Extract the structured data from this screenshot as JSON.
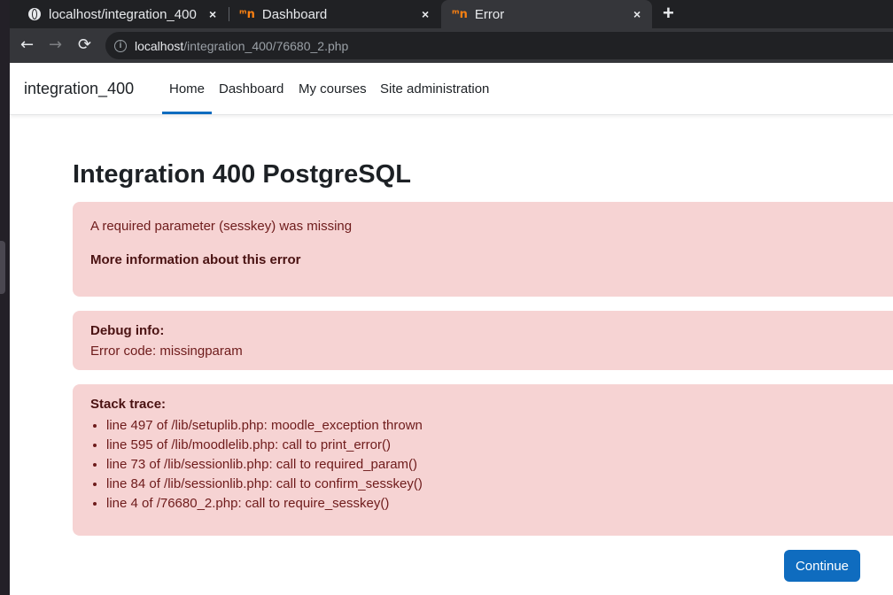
{
  "browser": {
    "tabs": [
      {
        "title": "localhost/integration_400"
      },
      {
        "title": "Dashboard"
      },
      {
        "title": "Error"
      }
    ],
    "new_tab_label": "+",
    "close_label": "×",
    "url_host": "localhost",
    "url_path": "/integration_400/76680_2.php"
  },
  "navbar": {
    "brand": "integration_400",
    "links": [
      "Home",
      "Dashboard",
      "My courses",
      "Site administration"
    ],
    "active": "Home"
  },
  "page": {
    "title": "Integration 400 PostgreSQL",
    "error_message": "A required parameter (sesskey) was missing",
    "more_info": "More information about this error",
    "debug_heading": "Debug info:",
    "debug_text": "Error code: missingparam",
    "stack_heading": "Stack trace:",
    "stack_trace": [
      "line 497 of /lib/setuplib.php: moodle_exception thrown",
      "line 595 of /lib/moodlelib.php: call to print_error()",
      "line 73 of /lib/sessionlib.php: call to required_param()",
      "line 84 of /lib/sessionlib.php: call to confirm_sesskey()",
      "line 4 of /76680_2.php: call to require_sesskey()"
    ],
    "continue_label": "Continue"
  },
  "colors": {
    "accent": "#0f6cbf",
    "alert_bg": "#f6d3d3",
    "alert_text": "#6e1b1b"
  },
  "icons": [
    "globe-icon",
    "moodle-logo-icon",
    "close-icon",
    "plus-icon",
    "back-arrow-icon",
    "forward-arrow-icon",
    "reload-icon",
    "info-icon"
  ]
}
